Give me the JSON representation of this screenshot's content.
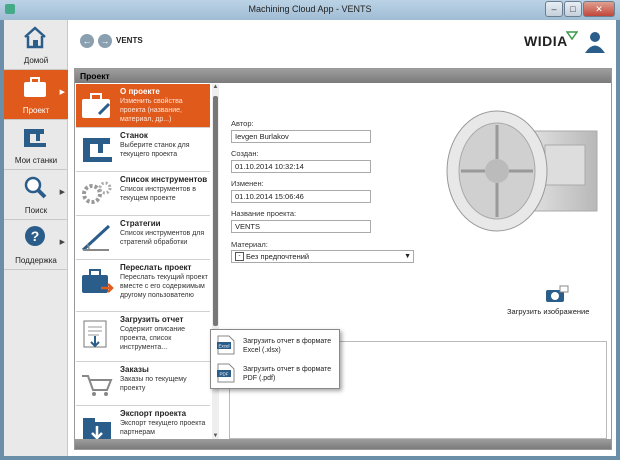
{
  "window": {
    "title": "Machining Cloud App - VENTS",
    "minimize": "–",
    "maximize": "□",
    "close": "✕"
  },
  "nav": {
    "items": [
      {
        "label": "Домой",
        "icon": "home-icon"
      },
      {
        "label": "Проект",
        "icon": "briefcase-icon",
        "active": true
      },
      {
        "label": "Мои станки",
        "icon": "machine-icon"
      },
      {
        "label": "Поиск",
        "icon": "search-icon"
      },
      {
        "label": "Поддержка",
        "icon": "help-icon"
      }
    ]
  },
  "header": {
    "back": "←",
    "forward": "→",
    "breadcrumb": "VENTS",
    "brand": "WIDIA"
  },
  "panel": {
    "title": "Проект"
  },
  "menu": [
    {
      "title": "О проекте",
      "desc": "Изменить свойства проекта (название, материал, др...)",
      "icon": "briefcase-wrench-icon",
      "active": true
    },
    {
      "title": "Станок",
      "desc": "Выберите станок для текущего проекта",
      "icon": "machine-icon"
    },
    {
      "title": "Список инструментов",
      "desc": "Список инструментов в текущем проекте",
      "icon": "gears-icon"
    },
    {
      "title": "Стратегии",
      "desc": "Список инструментов для стратегий обработки",
      "icon": "strategy-icon"
    },
    {
      "title": "Переслать проект",
      "desc": "Переслать текущий проект вместе с его содержимым другому пользователю",
      "icon": "forward-icon"
    },
    {
      "title": "Загрузить отчет",
      "desc": "Содержит описание проекта, список инструмента...",
      "icon": "report-icon"
    },
    {
      "title": "Заказы",
      "desc": "Заказы по текущему проекту",
      "icon": "orders-icon"
    },
    {
      "title": "Экспорт проекта",
      "desc": "Экспорт текущего проекта партнерам",
      "icon": "export-icon"
    }
  ],
  "form": {
    "author_label": "Автор:",
    "author": "Ievgen Burlakov",
    "created_label": "Создан:",
    "created": "01.10.2014 10:32:14",
    "modified_label": "Изменен:",
    "modified": "01.10.2014 15:06:46",
    "name_label": "Название проекта:",
    "name": "VENTS",
    "material_label": "Материал:",
    "material": "Без предпочтений",
    "material_box": "-"
  },
  "upload": {
    "label": "Загрузить изображение"
  },
  "popup": [
    {
      "text": "Загрузить отчет в формате Excel (.xlsx)",
      "icon": "excel-file-icon",
      "badge": "Excel"
    },
    {
      "text": "Загрузить отчет в формате PDF (.pdf)",
      "icon": "pdf-file-icon",
      "badge": "PDF"
    }
  ],
  "colors": {
    "accent": "#e05a1c",
    "nav_bg": "#e9e9e9",
    "panel_header": "#8a8a8a"
  }
}
